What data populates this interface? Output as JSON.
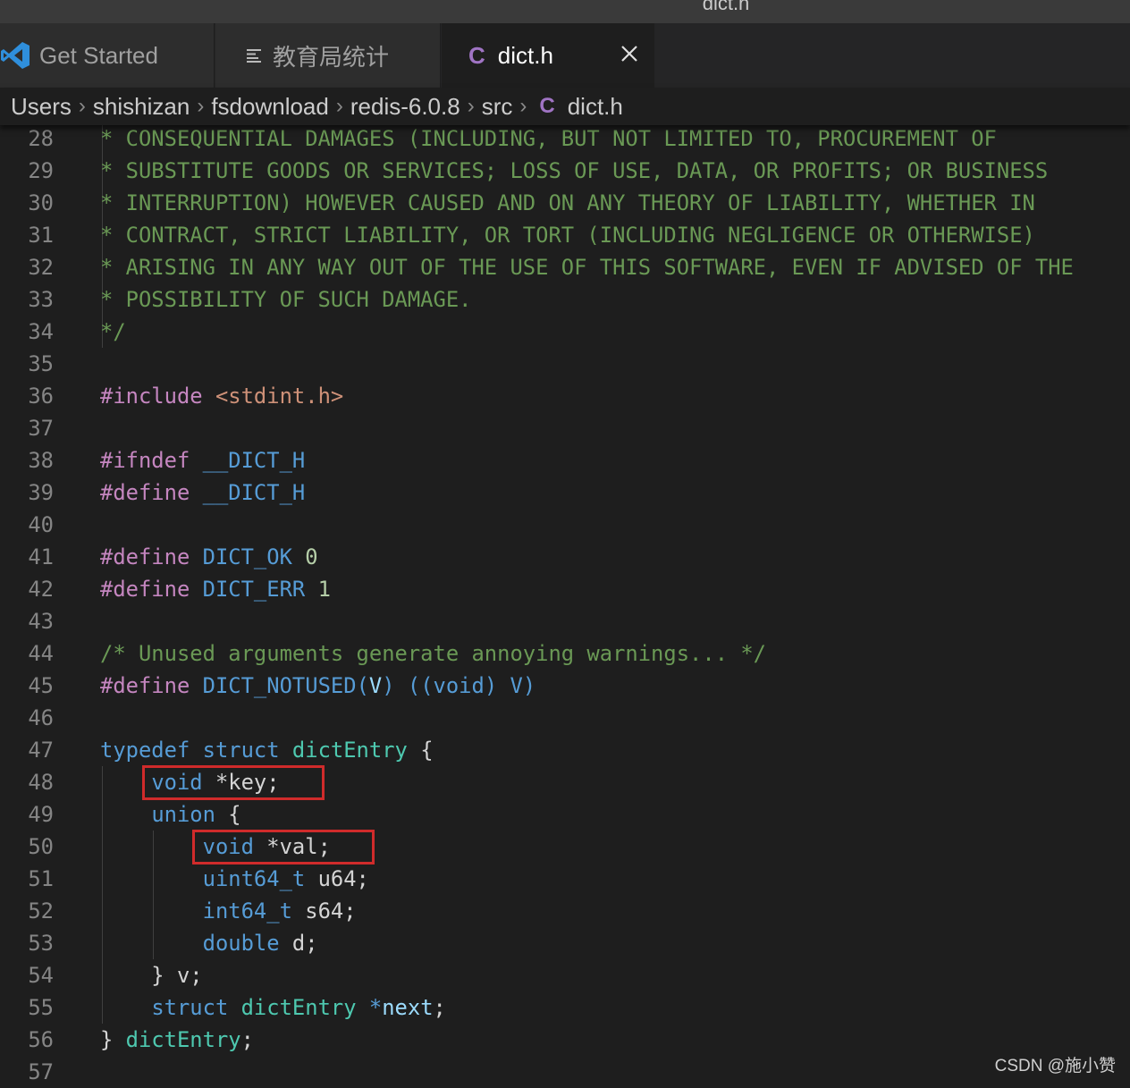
{
  "window": {
    "title": "dict.h"
  },
  "tabs": [
    {
      "label": "Get Started",
      "icon": "vscode-logo-icon",
      "active": false
    },
    {
      "label": "教育局统计",
      "icon": "list-icon",
      "active": false
    },
    {
      "label": "dict.h",
      "icon": "c-file-icon",
      "active": true
    }
  ],
  "breadcrumbs": [
    "Users",
    "shishizan",
    "fsdownload",
    "redis-6.0.8",
    "src",
    "dict.h"
  ],
  "breadcrumb_file_icon": "C",
  "editor": {
    "lines": [
      {
        "n": "28",
        "indent": 1,
        "tokens": [
          {
            "t": "* CONSEQUENTIAL DAMAGES (INCLUDING, BUT NOT LIMITED TO, PROCUREMENT OF",
            "c": "comment"
          }
        ]
      },
      {
        "n": "29",
        "indent": 1,
        "tokens": [
          {
            "t": "* SUBSTITUTE GOODS OR SERVICES; LOSS OF USE, DATA, OR PROFITS; OR BUSINESS",
            "c": "comment"
          }
        ]
      },
      {
        "n": "30",
        "indent": 1,
        "tokens": [
          {
            "t": "* INTERRUPTION) HOWEVER CAUSED AND ON ANY THEORY OF LIABILITY, WHETHER IN",
            "c": "comment"
          }
        ]
      },
      {
        "n": "31",
        "indent": 1,
        "tokens": [
          {
            "t": "* CONTRACT, STRICT LIABILITY, OR TORT (INCLUDING NEGLIGENCE OR OTHERWISE)",
            "c": "comment"
          }
        ]
      },
      {
        "n": "32",
        "indent": 1,
        "tokens": [
          {
            "t": "* ARISING IN ANY WAY OUT OF THE USE OF THIS SOFTWARE, EVEN IF ADVISED OF THE",
            "c": "comment"
          }
        ]
      },
      {
        "n": "33",
        "indent": 1,
        "tokens": [
          {
            "t": "* POSSIBILITY OF SUCH DAMAGE.",
            "c": "comment"
          }
        ]
      },
      {
        "n": "34",
        "indent": 1,
        "tokens": [
          {
            "t": "*/",
            "c": "comment"
          }
        ]
      },
      {
        "n": "35",
        "indent": 0,
        "tokens": []
      },
      {
        "n": "36",
        "indent": 0,
        "tokens": [
          {
            "t": "#include ",
            "c": "pp"
          },
          {
            "t": "<stdint.h>",
            "c": "str"
          }
        ]
      },
      {
        "n": "37",
        "indent": 0,
        "tokens": []
      },
      {
        "n": "38",
        "indent": 0,
        "tokens": [
          {
            "t": "#ifndef ",
            "c": "pp"
          },
          {
            "t": "__DICT_H",
            "c": "macro"
          }
        ]
      },
      {
        "n": "39",
        "indent": 0,
        "tokens": [
          {
            "t": "#define ",
            "c": "pp"
          },
          {
            "t": "__DICT_H",
            "c": "macro"
          }
        ]
      },
      {
        "n": "40",
        "indent": 0,
        "tokens": []
      },
      {
        "n": "41",
        "indent": 0,
        "tokens": [
          {
            "t": "#define ",
            "c": "pp"
          },
          {
            "t": "DICT_OK",
            "c": "macro"
          },
          {
            "t": " ",
            "c": "plain"
          },
          {
            "t": "0",
            "c": "num"
          }
        ]
      },
      {
        "n": "42",
        "indent": 0,
        "tokens": [
          {
            "t": "#define ",
            "c": "pp"
          },
          {
            "t": "DICT_ERR",
            "c": "macro"
          },
          {
            "t": " ",
            "c": "plain"
          },
          {
            "t": "1",
            "c": "num"
          }
        ]
      },
      {
        "n": "43",
        "indent": 0,
        "tokens": []
      },
      {
        "n": "44",
        "indent": 0,
        "tokens": [
          {
            "t": "/* Unused arguments generate annoying warnings... */",
            "c": "comment"
          }
        ]
      },
      {
        "n": "45",
        "indent": 0,
        "tokens": [
          {
            "t": "#define ",
            "c": "pp"
          },
          {
            "t": "DICT_NOTUSED",
            "c": "macro"
          },
          {
            "t": "(",
            "c": "macro"
          },
          {
            "t": "V",
            "c": "var"
          },
          {
            "t": ") ((void) V)",
            "c": "macro"
          }
        ]
      },
      {
        "n": "46",
        "indent": 0,
        "tokens": []
      },
      {
        "n": "47",
        "indent": 0,
        "tokens": [
          {
            "t": "typedef",
            "c": "kw"
          },
          {
            "t": " ",
            "c": "plain"
          },
          {
            "t": "struct",
            "c": "kw"
          },
          {
            "t": " ",
            "c": "plain"
          },
          {
            "t": "dictEntry",
            "c": "type"
          },
          {
            "t": " {",
            "c": "plain"
          }
        ]
      },
      {
        "n": "48",
        "indent": 1,
        "tokens": [
          {
            "t": "    ",
            "c": "plain"
          },
          {
            "t": "void",
            "c": "kw"
          },
          {
            "t": " *",
            "c": "plain"
          },
          {
            "t": "key",
            "c": "plain"
          },
          {
            "t": ";",
            "c": "plain"
          }
        ]
      },
      {
        "n": "49",
        "indent": 1,
        "tokens": [
          {
            "t": "    ",
            "c": "plain"
          },
          {
            "t": "union",
            "c": "kw"
          },
          {
            "t": " {",
            "c": "plain"
          }
        ]
      },
      {
        "n": "50",
        "indent": 2,
        "tokens": [
          {
            "t": "        ",
            "c": "plain"
          },
          {
            "t": "void",
            "c": "kw"
          },
          {
            "t": " *",
            "c": "plain"
          },
          {
            "t": "val",
            "c": "plain"
          },
          {
            "t": ";",
            "c": "plain"
          }
        ]
      },
      {
        "n": "51",
        "indent": 2,
        "tokens": [
          {
            "t": "        ",
            "c": "plain"
          },
          {
            "t": "uint64_t",
            "c": "kw"
          },
          {
            "t": " u64;",
            "c": "plain"
          }
        ]
      },
      {
        "n": "52",
        "indent": 2,
        "tokens": [
          {
            "t": "        ",
            "c": "plain"
          },
          {
            "t": "int64_t",
            "c": "kw"
          },
          {
            "t": " s64;",
            "c": "plain"
          }
        ]
      },
      {
        "n": "53",
        "indent": 2,
        "tokens": [
          {
            "t": "        ",
            "c": "plain"
          },
          {
            "t": "double",
            "c": "kw"
          },
          {
            "t": " d;",
            "c": "plain"
          }
        ]
      },
      {
        "n": "54",
        "indent": 1,
        "tokens": [
          {
            "t": "    } v;",
            "c": "plain"
          }
        ]
      },
      {
        "n": "55",
        "indent": 1,
        "tokens": [
          {
            "t": "    ",
            "c": "plain"
          },
          {
            "t": "struct",
            "c": "kw"
          },
          {
            "t": " ",
            "c": "plain"
          },
          {
            "t": "dictEntry",
            "c": "type"
          },
          {
            "t": " ",
            "c": "plain"
          },
          {
            "t": "*",
            "c": "kw"
          },
          {
            "t": "next",
            "c": "var"
          },
          {
            "t": ";",
            "c": "plain"
          }
        ]
      },
      {
        "n": "56",
        "indent": 0,
        "tokens": [
          {
            "t": "} ",
            "c": "plain"
          },
          {
            "t": "dictEntry",
            "c": "type"
          },
          {
            "t": ";",
            "c": "plain"
          }
        ]
      },
      {
        "n": "57",
        "indent": 0,
        "tokens": []
      }
    ],
    "highlighted_lines": [
      "48",
      "50"
    ]
  },
  "watermark": "CSDN @施小赞",
  "colors": {
    "background": "#1e1e1e",
    "comment": "#6a9955",
    "preprocessor": "#c586c0",
    "keyword": "#569cd6",
    "type": "#4ec9b0",
    "highlight_box": "#d02b2b"
  }
}
